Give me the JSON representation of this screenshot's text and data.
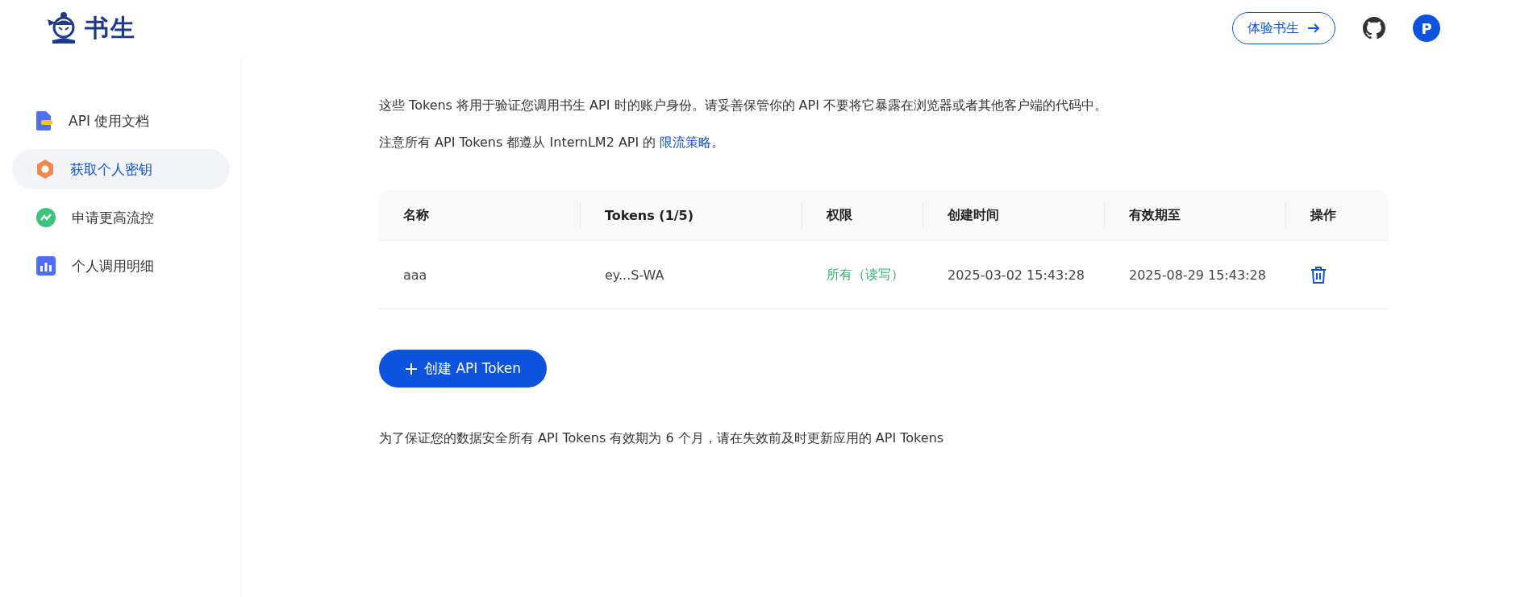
{
  "header": {
    "logo_text": "书生",
    "try_button": "体验书生",
    "avatar_letter": "P"
  },
  "sidebar": {
    "items": [
      {
        "label": "API 使用文档",
        "selected": false
      },
      {
        "label": "获取个人密钥",
        "selected": true
      },
      {
        "label": "申请更高流控",
        "selected": false
      },
      {
        "label": "个人调用明细",
        "selected": false
      }
    ]
  },
  "intro": "这些 Tokens 将用于验证您调用书生 API 时的账户身份。请妥善保管你的 API 不要将它暴露在浏览器或者其他客户端的代码中。",
  "note": {
    "before": "注意所有 API Tokens 都遵从 InternLM2 API 的 ",
    "link": "限流策略",
    "after": "。"
  },
  "table": {
    "columns": [
      "名称",
      "Tokens (1/5)",
      "权限",
      "创建时间",
      "有效期至",
      "操作"
    ],
    "rows": [
      {
        "name": "aaa",
        "token": "ey...S-WA",
        "permission": "所有（读写）",
        "created": "2025-03-02 15:43:28",
        "expires": "2025-08-29 15:43:28"
      }
    ]
  },
  "create_button": "创建 API Token",
  "footer_note": "为了保证您的数据安全所有 API Tokens 有效期为 6 个月，请在失效前及时更新应用的 API Tokens"
}
